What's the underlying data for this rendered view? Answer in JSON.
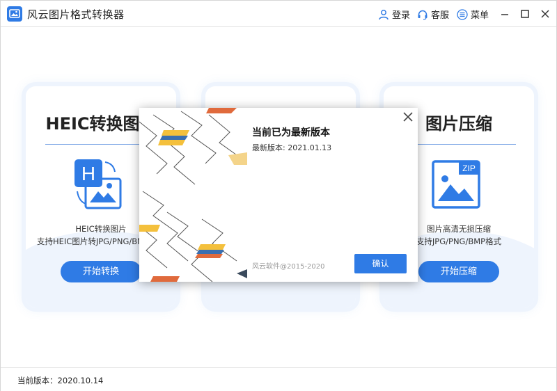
{
  "app": {
    "title": "风云图片格式转换器",
    "accent_color": "#2f7be5"
  },
  "topbar": {
    "login_label": "登录",
    "login_icon": "user-icon",
    "service_label": "客服",
    "service_icon": "headset-icon",
    "menu_label": "菜单",
    "menu_icon": "menu-list-icon",
    "window_controls": [
      "minimize-icon",
      "maximize-icon",
      "close-icon"
    ]
  },
  "cards": [
    {
      "title": "HEIC转换图片",
      "icon": "heic-convert-icon",
      "desc1": "HEIC转换图片",
      "desc2": "支持HEIC图片转JPG/PNG/BMP格式",
      "button": "开始转换"
    },
    {
      "title": "",
      "icon": "",
      "desc1": "",
      "desc2": "",
      "button": ""
    },
    {
      "title": "图片压缩",
      "icon": "zip-image-icon",
      "desc1": "图片高清无损压缩",
      "desc2": "支持JPG/PNG/BMP格式",
      "button": "开始压缩"
    }
  ],
  "statusbar": {
    "current_version": "当前版本：2020.10.14"
  },
  "modal": {
    "title": "当前已为最新版本",
    "latest_version": "最新版本: 2021.01.13",
    "copyright": "风云软件@2015-2020",
    "confirm_label": "确认",
    "close_icon": "close-icon"
  }
}
